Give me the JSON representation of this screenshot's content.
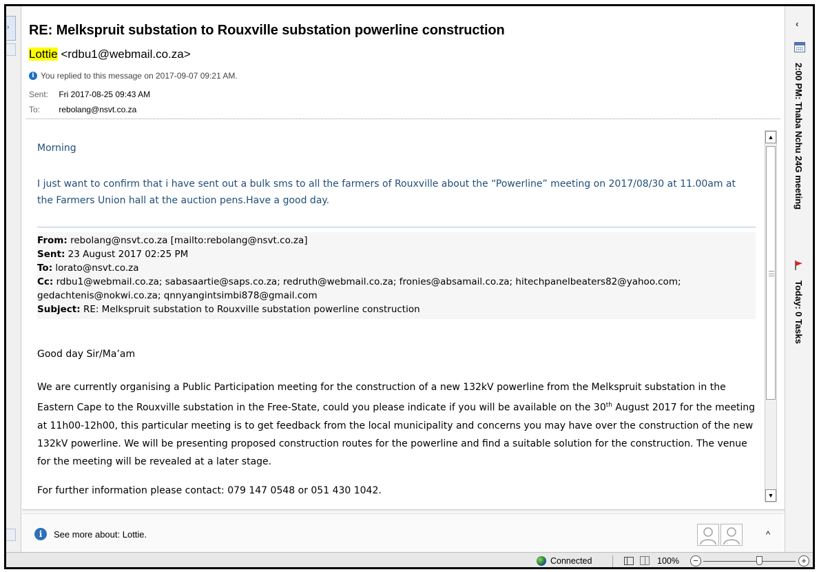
{
  "message": {
    "subject": "RE: Melkspruit substation to Rouxville substation powerline construction",
    "sender_name": "Lottie",
    "sender_email": "<rdbu1@webmail.co.za>",
    "replied_notice": "You replied to this message on 2017-09-07 09:21 AM.",
    "sent_label": "Sent:",
    "sent_value": "Fri 2017-08-25 09:43 AM",
    "to_label": "To:",
    "to_value": "rebolang@nsvt.co.za"
  },
  "body": {
    "greeting": "Morning",
    "confirm": "I just want to confirm that i have sent out a bulk sms to all the farmers of Rouxville about the “Powerline” meeting on 2017/08/30 at 11.00am at the Farmers Union hall at the auction pens.Have a good day.",
    "quoted": {
      "from_label": "From:",
      "from_value": "rebolang@nsvt.co.za [mailto:rebolang@nsvt.co.za]",
      "sent_label": "Sent:",
      "sent_value": "23 August 2017 02:25 PM",
      "to_label": "To:",
      "to_value": "lorato@nsvt.co.za",
      "cc_label": "Cc:",
      "cc_value": "rdbu1@webmail.co.za; sabasaartie@saps.co.za; redruth@webmail.co.za; fronies@absamail.co.za; hitechpanelbeaters82@yahoo.com; gedachtenis@nokwi.co.za; qnnyangintsimbi878@gmail.com",
      "subject_label": "Subject:",
      "subject_value": "RE: Melkspruit substation to Rouxville substation powerline construction"
    },
    "good_day": "Good day Sir/Ma’am",
    "para_part1": "We are currently organising a Public Participation meeting for the construction of a new 132kV powerline from the Melkspruit substation in the Eastern Cape to the Rouxville substation in the Free-State, could you please indicate if you will be available on the 30",
    "para_sup": "th",
    "para_part2": " August 2017 for the meeting at 11h00-12h00, this particular meeting is to get feedback from the local municipality and concerns you may have over the construction of the new 132kV powerline. We will be presenting proposed construction routes for the powerline and find a suitable solution for the construction. The venue for the meeting will be revealed at a later stage.",
    "further": "For further information please contact: 079 147 0548 or 051 430 1042."
  },
  "people_pane": {
    "see_more": "See more about: Lottie."
  },
  "todo_bar": {
    "appointment": "2:00 PM: Thaba Nchu 24G meeting",
    "tasks": "Today: 0 Tasks"
  },
  "status_bar": {
    "connection": "Connected",
    "zoom": "100%",
    "zoom_minus": "−",
    "zoom_plus": "+"
  },
  "colors": {
    "sender_highlight": "#ffff00",
    "body_blue": "#1f4e79",
    "info_icon": "#1e6fc6"
  }
}
